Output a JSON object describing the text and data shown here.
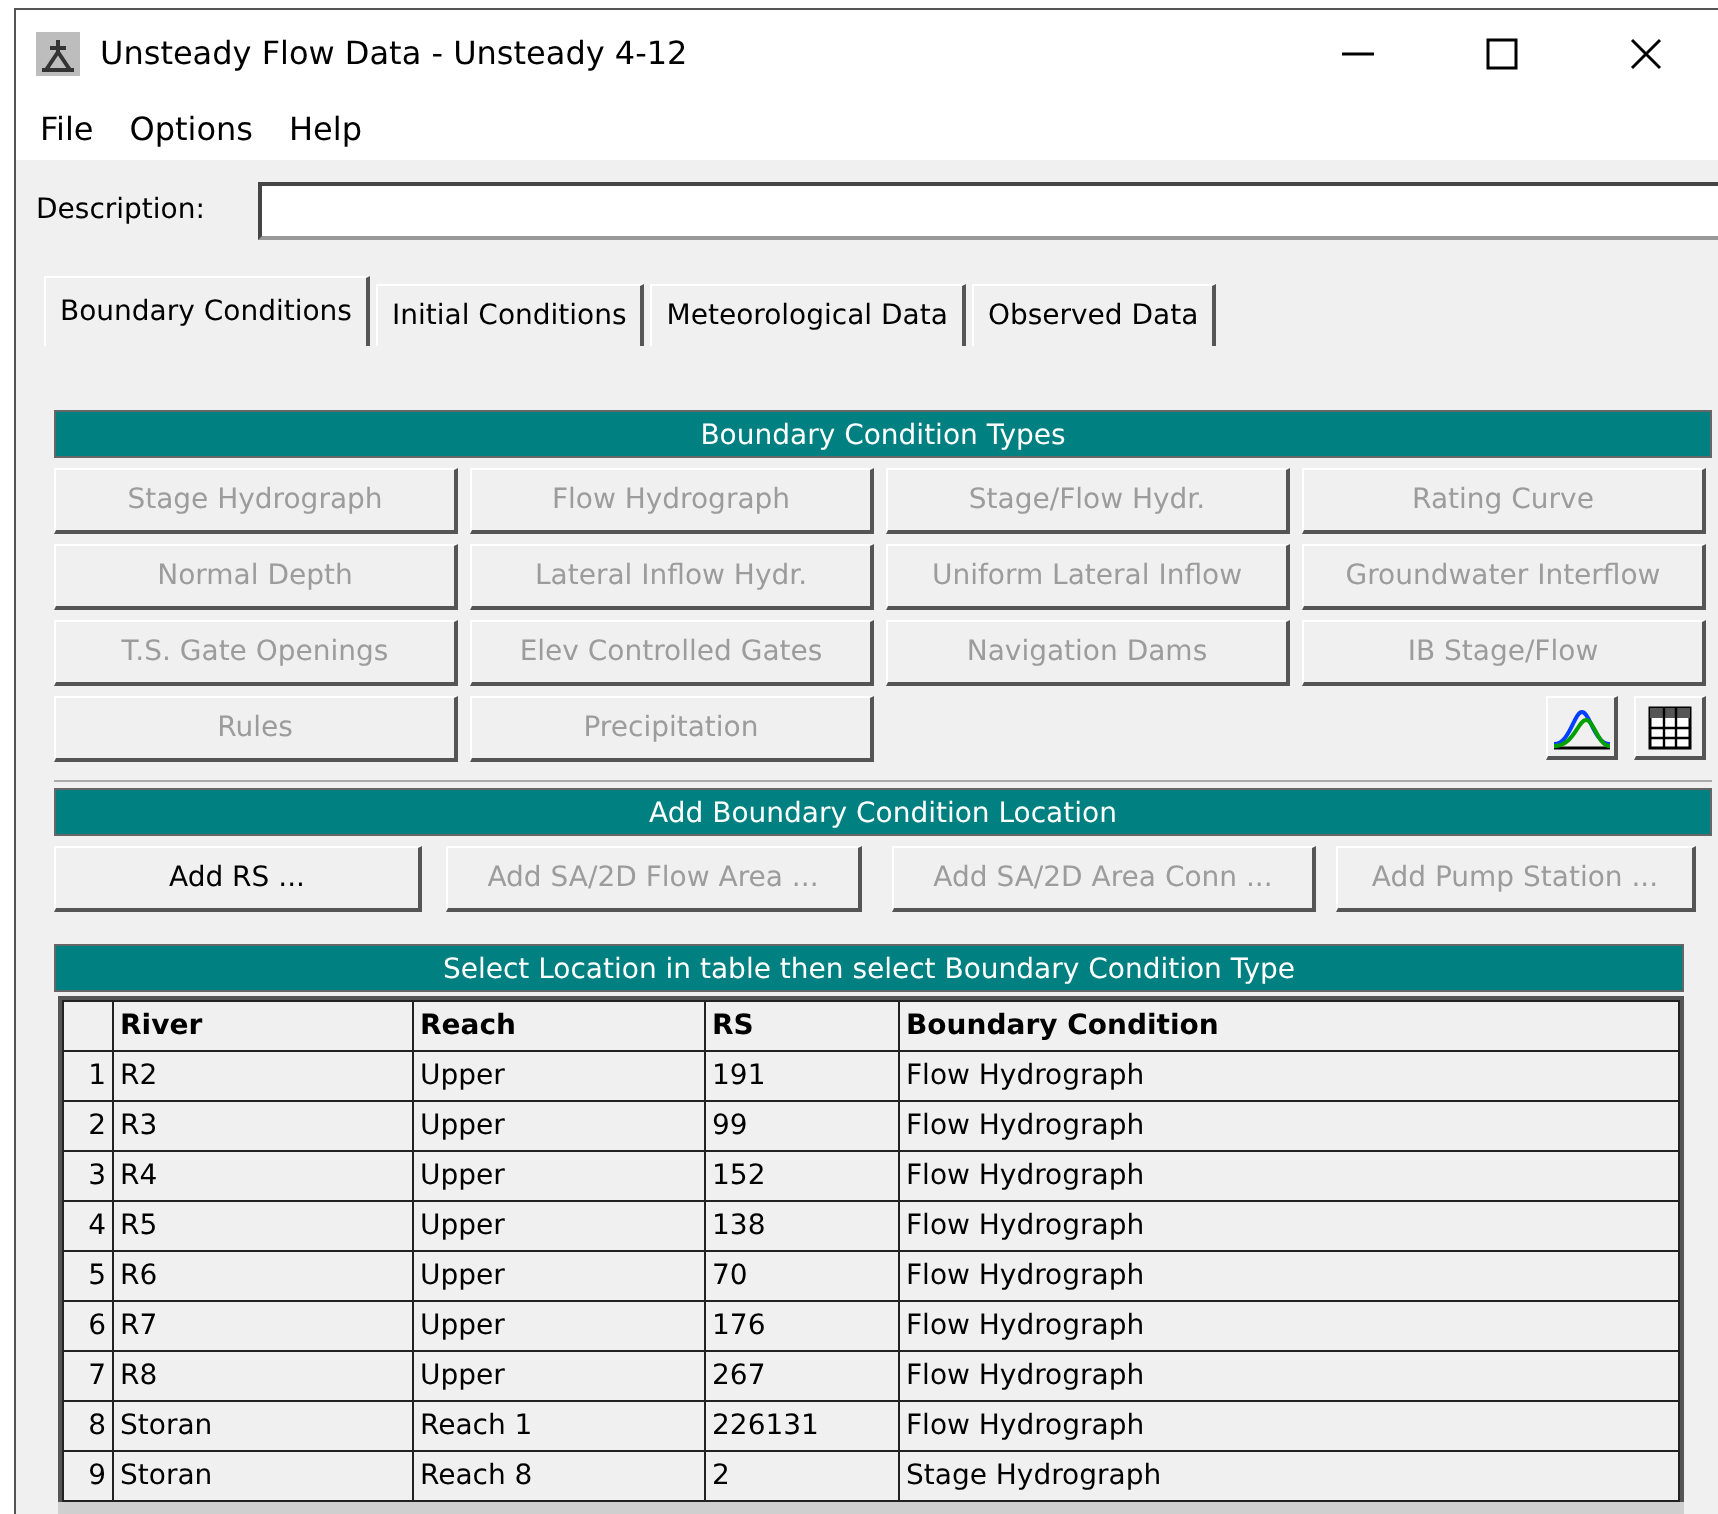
{
  "window": {
    "title": "Unsteady Flow Data - Unsteady 4-12"
  },
  "menu": [
    "File",
    "Options",
    "Help"
  ],
  "description": {
    "label": "Description:"
  },
  "tabs": [
    {
      "label": "Boundary Conditions",
      "selected": true
    },
    {
      "label": "Initial Conditions",
      "selected": false
    },
    {
      "label": "Meteorological Data",
      "selected": false
    },
    {
      "label": "Observed Data",
      "selected": false
    }
  ],
  "boundary_condition_types": {
    "title": "Boundary Condition Types",
    "buttons": [
      {
        "label": "Stage Hydrograph",
        "disabled": true
      },
      {
        "label": "Flow Hydrograph",
        "disabled": true
      },
      {
        "label": "Stage/Flow Hydr.",
        "disabled": true
      },
      {
        "label": "Rating Curve",
        "disabled": true
      },
      {
        "label": "Normal Depth",
        "disabled": true
      },
      {
        "label": "Lateral Inflow Hydr.",
        "disabled": true
      },
      {
        "label": "Uniform Lateral Inflow",
        "disabled": true
      },
      {
        "label": "Groundwater Interflow",
        "disabled": true
      },
      {
        "label": "T.S. Gate Openings",
        "disabled": true
      },
      {
        "label": "Elev Controlled Gates",
        "disabled": true
      },
      {
        "label": "Navigation Dams",
        "disabled": true
      },
      {
        "label": "IB Stage/Flow",
        "disabled": true
      },
      {
        "label": "Rules",
        "disabled": true
      },
      {
        "label": "Precipitation",
        "disabled": true
      }
    ]
  },
  "add_location": {
    "title": "Add Boundary Condition Location",
    "buttons": [
      {
        "label": "Add RS ...",
        "disabled": false
      },
      {
        "label": "Add SA/2D Flow Area ...",
        "disabled": true
      },
      {
        "label": "Add SA/2D Area Conn ...",
        "disabled": true
      },
      {
        "label": "Add Pump Station ...",
        "disabled": true
      }
    ]
  },
  "table": {
    "title": "Select Location in table then select Boundary Condition Type",
    "columns": [
      "River",
      "Reach",
      "RS",
      "Boundary Condition"
    ],
    "rows": [
      {
        "number": "1",
        "cells": [
          "R2",
          "Upper",
          "191",
          "Flow Hydrograph"
        ]
      },
      {
        "number": "2",
        "cells": [
          "R3",
          "Upper",
          "99",
          "Flow Hydrograph"
        ]
      },
      {
        "number": "3",
        "cells": [
          "R4",
          "Upper",
          "152",
          "Flow Hydrograph"
        ]
      },
      {
        "number": "4",
        "cells": [
          "R5",
          "Upper",
          "138",
          "Flow Hydrograph"
        ]
      },
      {
        "number": "5",
        "cells": [
          "R6",
          "Upper",
          "70",
          "Flow Hydrograph"
        ]
      },
      {
        "number": "6",
        "cells": [
          "R7",
          "Upper",
          "176",
          "Flow Hydrograph"
        ]
      },
      {
        "number": "7",
        "cells": [
          "R8",
          "Upper",
          "267",
          "Flow Hydrograph"
        ]
      },
      {
        "number": "8",
        "cells": [
          "Storan",
          "Reach 1",
          "226131",
          "Flow Hydrograph"
        ]
      },
      {
        "number": "9",
        "cells": [
          "Storan",
          "Reach 8",
          "2",
          "Stage Hydrograph"
        ]
      }
    ]
  }
}
